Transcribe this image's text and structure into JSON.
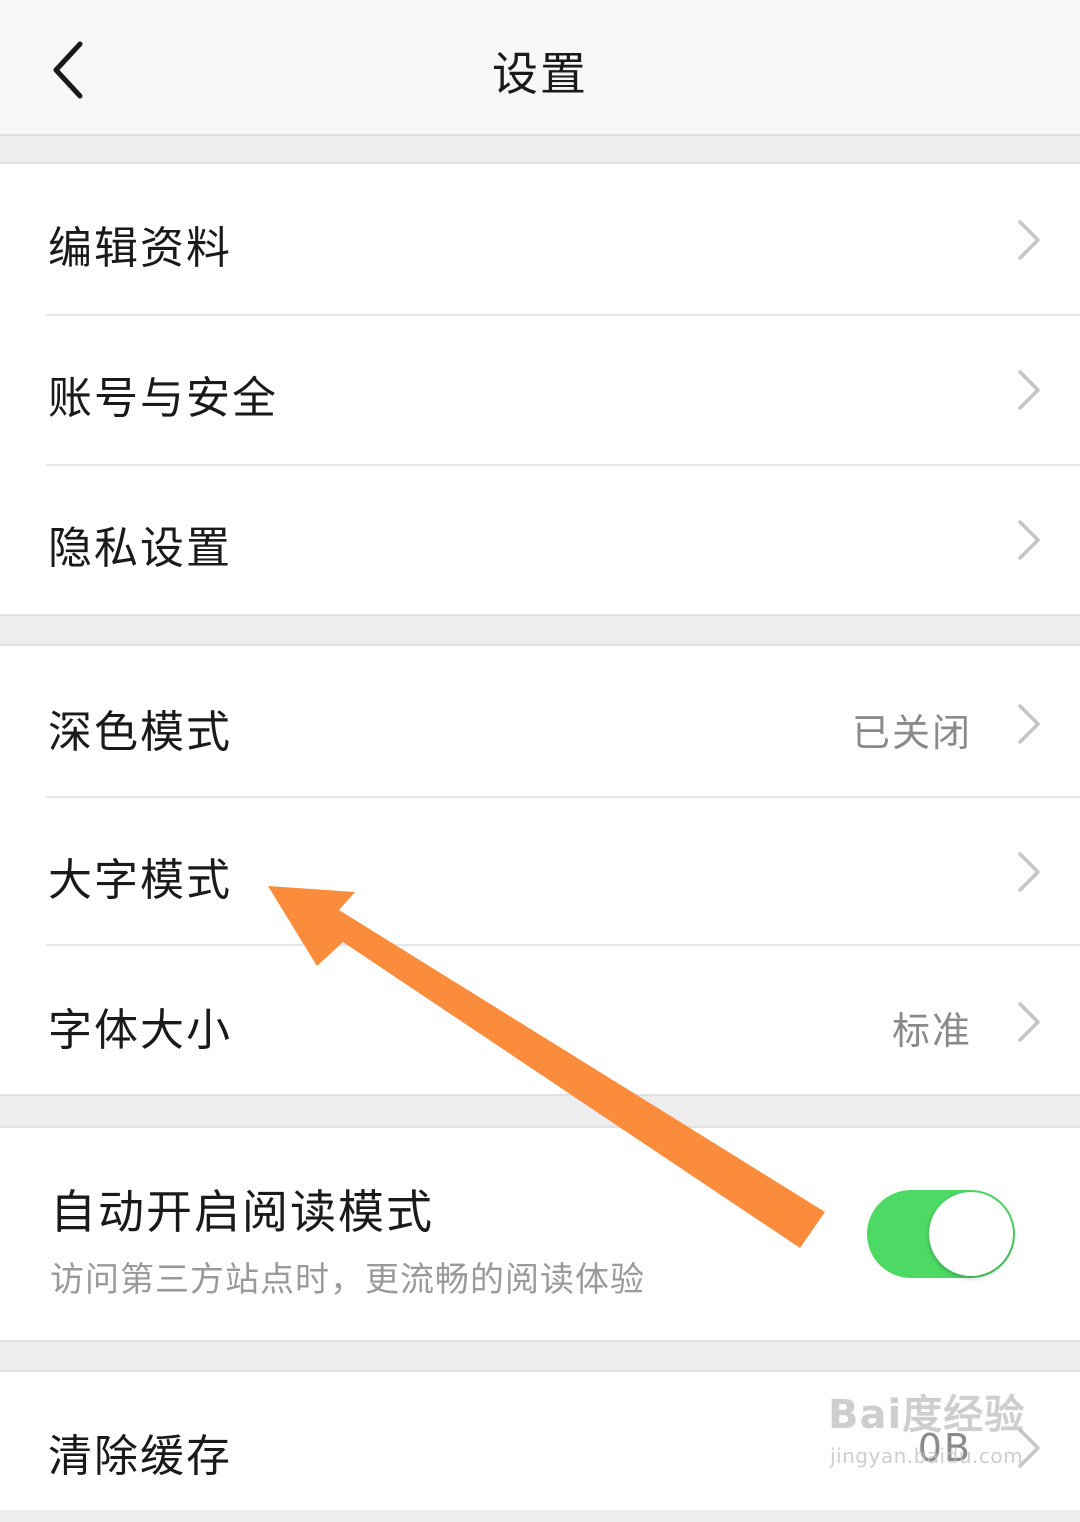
{
  "header": {
    "title": "设置",
    "back_icon": "chevron-left-icon"
  },
  "groups": {
    "account": [
      {
        "label": "编辑资料"
      },
      {
        "label": "账号与安全"
      },
      {
        "label": "隐私设置"
      }
    ],
    "display": [
      {
        "label": "深色模式",
        "value": "已关闭"
      },
      {
        "label": "大字模式"
      },
      {
        "label": "字体大小",
        "value": "标准"
      }
    ],
    "reader": {
      "title": "自动开启阅读模式",
      "subtitle": "访问第三方站点时，更流畅的阅读体验",
      "enabled": true
    },
    "storage": {
      "label": "清除缓存",
      "value": "0B"
    }
  },
  "watermark": {
    "main": "Bai度经验",
    "sub": "jingyan.baidu.com"
  },
  "colors": {
    "toggle_on": "#4cd964",
    "annotation_arrow": "#fb8c3c",
    "background": "#ededed"
  }
}
